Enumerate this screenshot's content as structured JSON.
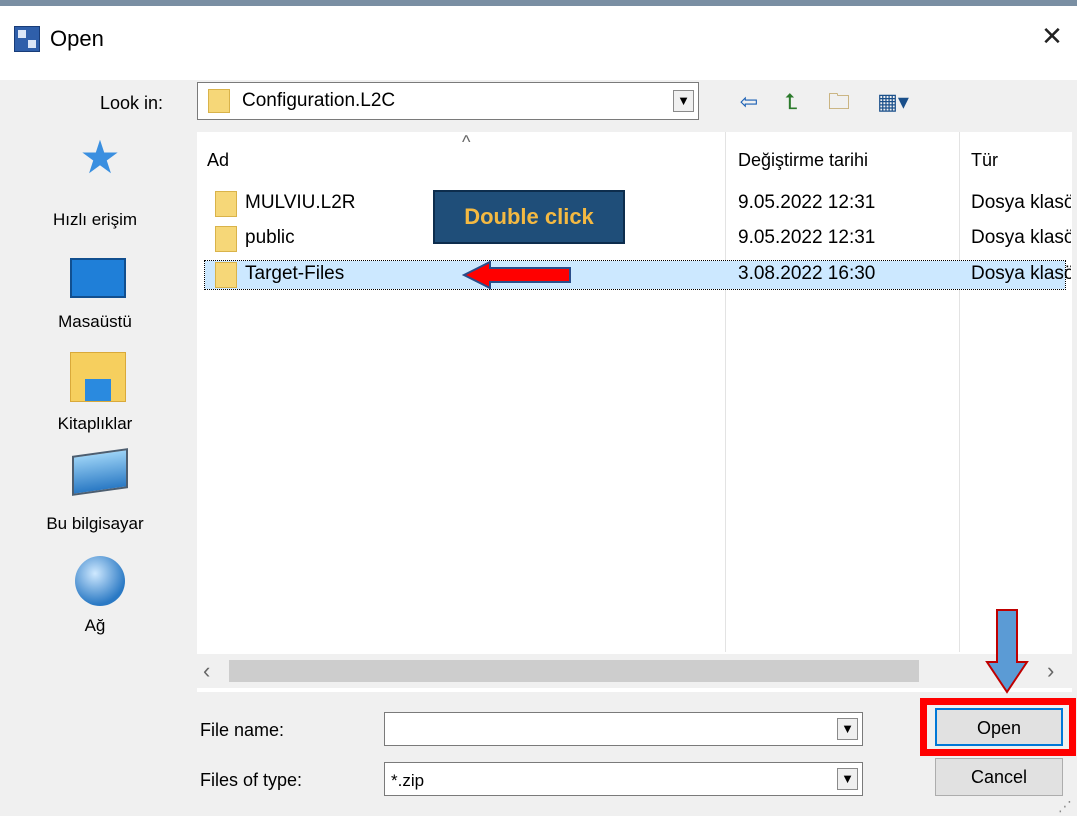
{
  "window": {
    "title": "Open",
    "close_glyph": "✕"
  },
  "toolbar": {
    "lookin_label": "Look in:",
    "lookin_value": "Configuration.L2C",
    "icons": [
      "back-icon",
      "up-folder-icon",
      "new-folder-icon",
      "views-menu-icon"
    ]
  },
  "places": [
    {
      "label": "Hızlı erişim",
      "icon": "quick-access-star-icon"
    },
    {
      "label": "Masaüstü",
      "icon": "desktop-icon"
    },
    {
      "label": "Kitaplıklar",
      "icon": "libraries-icon"
    },
    {
      "label": "Bu bilgisayar",
      "icon": "this-pc-icon"
    },
    {
      "label": "Ağ",
      "icon": "network-icon"
    }
  ],
  "filelist": {
    "columns": [
      "Ad",
      "Değiştirme tarihi",
      "Tür"
    ],
    "rows": [
      {
        "name": "MULVIU.L2R",
        "date": "9.05.2022 12:31",
        "type": "Dosya klasörü"
      },
      {
        "name": "public",
        "date": "9.05.2022 12:31",
        "type": "Dosya klasörü"
      },
      {
        "name": "Target-Files",
        "date": "3.08.2022 16:30",
        "type": "Dosya klasörü",
        "selected": true
      }
    ]
  },
  "annotation": {
    "hint": "Double click",
    "hint_bg": "#1f4e79",
    "hint_color": "#f4b942",
    "arrow_color": "#ff0000",
    "down_arrow_color": "#5b9bd5"
  },
  "bottom": {
    "filename_label": "File name:",
    "filename_value": "",
    "filetype_label": "Files of type:",
    "filetype_value": "*.zip",
    "open_label": "Open",
    "cancel_label": "Cancel"
  }
}
